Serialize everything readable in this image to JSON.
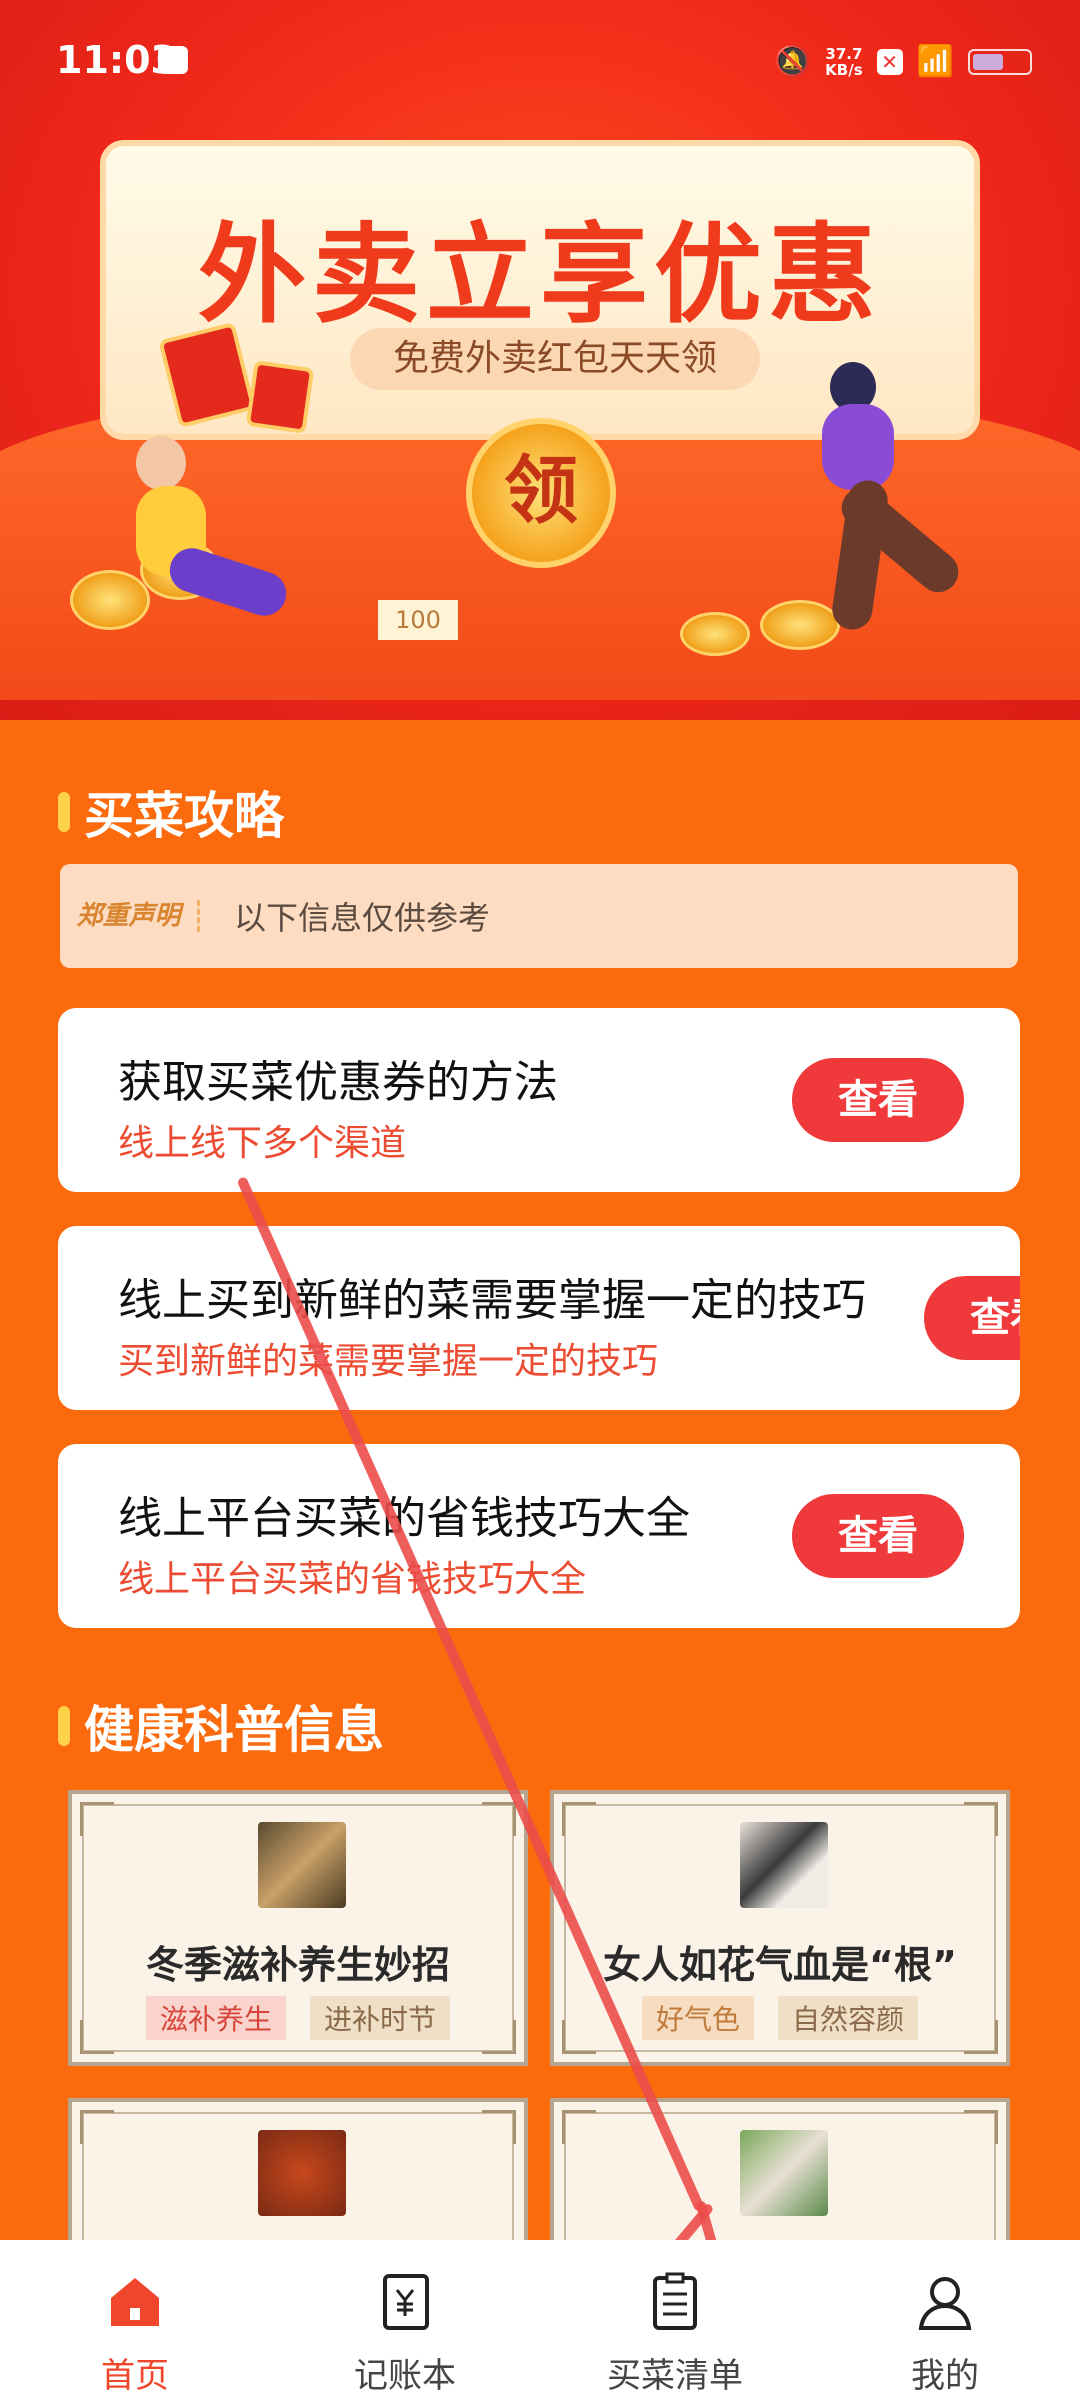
{
  "status_bar": {
    "time": "11:03",
    "net_speed_value": "37.7",
    "net_speed_unit": "KB/s",
    "battery_level": 0.55
  },
  "banner": {
    "title": "外卖立享优惠",
    "subtitle": "免费外卖红包天天领",
    "coin_label": "领",
    "ticket_label": "100"
  },
  "shopping_guide": {
    "title": "买菜攻略",
    "notice_badge": "郑重声明",
    "notice_text": "以下信息仅供参考",
    "items": [
      {
        "title": "获取买菜优惠券的方法",
        "subtitle": "线上线下多个渠道",
        "button": "查看"
      },
      {
        "title": "线上买到新鲜的菜需要掌握一定的技巧",
        "subtitle": "买到新鲜的菜需要掌握一定的技巧",
        "button": "查看"
      },
      {
        "title": "线上平台买菜的省钱技巧大全",
        "subtitle": "线上平台买菜的省钱技巧大全",
        "button": "查看"
      }
    ]
  },
  "health": {
    "title": "健康科普信息",
    "cards": [
      {
        "title": "冬季滋补养生妙招",
        "tags": [
          "滋补养生",
          "进补时节"
        ]
      },
      {
        "title": "女人如花气血是“根”",
        "tags": [
          "好气色",
          "自然容颜"
        ]
      }
    ]
  },
  "bottom_nav": {
    "items": [
      {
        "label": "首页",
        "icon": "home-icon",
        "active": true
      },
      {
        "label": "记账本",
        "icon": "ledger-icon",
        "active": false
      },
      {
        "label": "买菜清单",
        "icon": "list-icon",
        "active": false
      },
      {
        "label": "我的",
        "icon": "user-icon",
        "active": false
      }
    ]
  },
  "colors": {
    "background": "#fb6a0c",
    "accent_red": "#f0393a",
    "active_nav": "#f0472c",
    "section_bar": "#ffd24a"
  }
}
